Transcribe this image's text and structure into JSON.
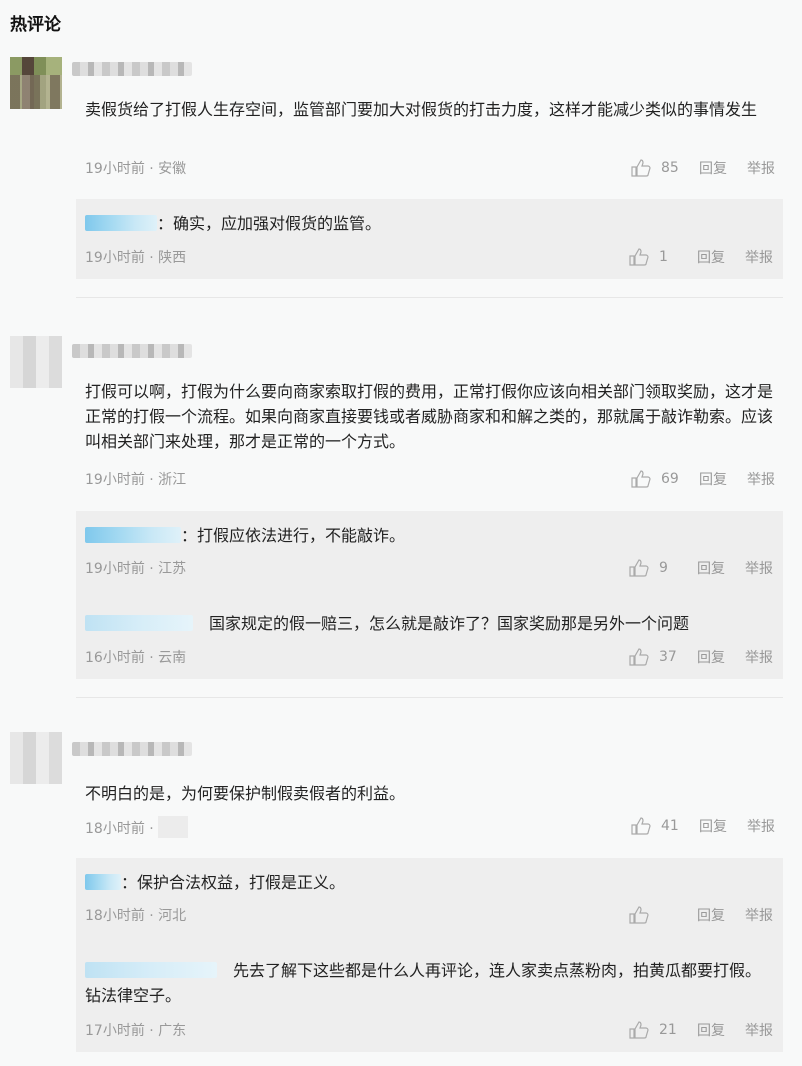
{
  "section_title": "热评论",
  "comments": [
    {
      "content": "卖假货给了打假人生存空间，监管部门要加大对假货的打击力度，这样才能减少类似的事情发生",
      "time": "19小时前 · 安徽",
      "likes": "85",
      "reply_label": "回复",
      "report_label": "举报",
      "replies": [
        {
          "text": "：确实，应加强对假货的监管。",
          "time": "19小时前 · 陕西",
          "likes": "1",
          "reply_label": "回复",
          "report_label": "举报"
        }
      ]
    },
    {
      "content": "打假可以啊，打假为什么要向商家索取打假的费用，正常打假你应该向相关部门领取奖励，这才是正常的打假一个流程。如果向商家直接要钱或者威胁商家和和解之类的，那就属于敲诈勒索。应该叫相关部门来处理，那才是正常的一个方式。",
      "time": "19小时前 · 浙江",
      "likes": "69",
      "reply_label": "回复",
      "report_label": "举报",
      "replies": [
        {
          "text": "：打假应依法进行，不能敲诈。",
          "time": "19小时前 · 江苏",
          "likes": "9",
          "reply_label": "回复",
          "report_label": "举报"
        },
        {
          "text": "国家规定的假一赔三，怎么就是敲诈了？国家奖励那是另外一个问题",
          "time": "16小时前 · 云南",
          "likes": "37",
          "reply_label": "回复",
          "report_label": "举报"
        }
      ]
    },
    {
      "content": "不明白的是，为何要保护制假卖假者的利益。",
      "time": "18小时前 ·",
      "likes": "41",
      "reply_label": "回复",
      "report_label": "举报",
      "replies": [
        {
          "text": "：保护合法权益，打假是正义。",
          "time": "18小时前 · 河北",
          "likes": "",
          "reply_label": "回复",
          "report_label": "举报"
        },
        {
          "text": "先去了解下这些都是什么人再评论，连人家卖点蒸粉肉，拍黄瓜都要打假。钻法律空子。",
          "time": "17小时前 · 广东",
          "likes": "21",
          "reply_label": "回复",
          "report_label": "举报"
        }
      ]
    }
  ],
  "icons": {
    "like": "thumbs-up-icon"
  },
  "colors": {
    "text": "#222222",
    "meta": "#999999",
    "reply_bg": "#eeeeee",
    "page_bg": "#f8f9f9"
  }
}
